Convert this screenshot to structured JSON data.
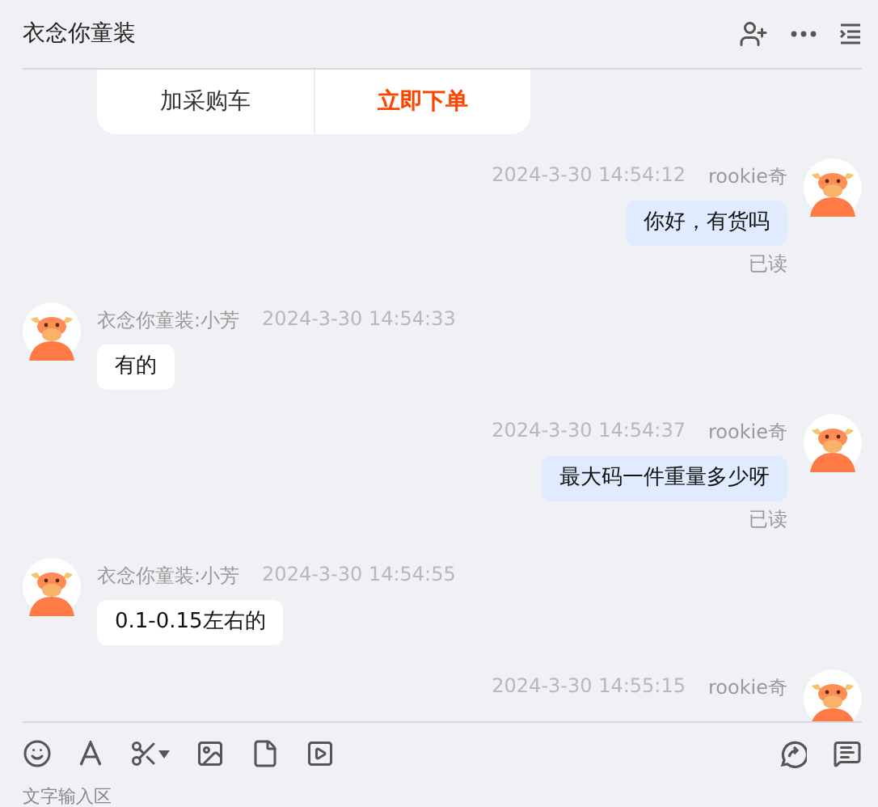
{
  "header": {
    "title": "衣念你童装"
  },
  "card": {
    "buttons": [
      {
        "label": "加采购车",
        "kind": "secondary"
      },
      {
        "label": "立即下单",
        "kind": "primary"
      }
    ]
  },
  "messages": [
    {
      "kind": "sent",
      "sender": "rookie奇",
      "time": "2024-3-30 14:54:12",
      "text": "你好，有货吗",
      "read_receipt": "已读"
    },
    {
      "kind": "received",
      "sender": "衣念你童装:小芳",
      "time": "2024-3-30 14:54:33",
      "text": "有的"
    },
    {
      "kind": "sent",
      "sender": "rookie奇",
      "time": "2024-3-30 14:54:37",
      "text": "最大码一件重量多少呀",
      "read_receipt": "已读"
    },
    {
      "kind": "received",
      "sender": "衣念你童装:小芳",
      "time": "2024-3-30 14:54:55",
      "text": "0.1-0.15左右的"
    },
    {
      "kind": "sent",
      "sender": "rookie奇",
      "time": "2024-3-30 14:55:15"
    }
  ],
  "input": {
    "placeholder": "文字输入区"
  }
}
